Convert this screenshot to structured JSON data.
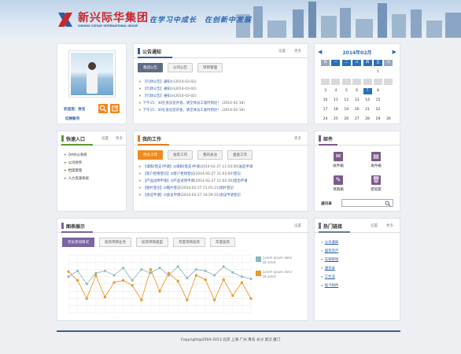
{
  "brand": {
    "name_cn": "新兴际华集团",
    "name_en": "XINXING CATHAY INTERNATIONAL GROUP",
    "slogan": "在学习中成长　在创新中发展"
  },
  "profile": {
    "welcome": "欢迎您：姓名",
    "switch_account": "切换账号"
  },
  "notice": {
    "title": "公告通知",
    "settings": "设置",
    "more": "更多",
    "tabs": [
      "集团公告",
      "公司公告",
      "项目管理"
    ],
    "items": [
      {
        "text": "【行政公告】通知①",
        "date": "(2014-03-02)"
      },
      {
        "text": "【行政公告】通知②",
        "date": "(2014-03-02)"
      },
      {
        "text": "【行政公告】通知③",
        "date": "(2014-03-02)"
      },
      {
        "text": "下午15：30在会议室开会，请全体员工准时到达！",
        "date": "(2014-02-18)"
      },
      {
        "text": "下午15：30在会议室开会，请全体员工准时到达！",
        "date": "(2014-02-18)"
      }
    ]
  },
  "calendar": {
    "month_title": "2014年02月",
    "weekdays": [
      "日",
      "一",
      "二",
      "三",
      "四",
      "五",
      "六"
    ],
    "days": [
      [
        "",
        "",
        "",
        "",
        "",
        "",
        "1"
      ],
      [
        "2",
        "3",
        "4",
        "5",
        "6",
        "7",
        "8"
      ],
      [
        "9",
        "10",
        "11",
        "12",
        "13",
        "14",
        "15"
      ],
      [
        "16",
        "17",
        "18",
        "19",
        "20",
        "21",
        "22"
      ],
      [
        "23",
        "24",
        "25",
        "26",
        "27",
        "28",
        ""
      ]
    ],
    "rows_shown": [
      [
        "",
        "",
        "",
        "",
        "",
        "",
        "1"
      ],
      [
        "",
        "",
        "",
        "",
        "",
        "",
        ""
      ],
      [
        "3",
        "4",
        "5",
        "6",
        "7",
        "8",
        ""
      ]
    ],
    "display": [
      [
        "",
        "",
        "",
        "",
        "",
        "1",
        ""
      ],
      [
        "",
        "",
        "",
        "",
        "",
        "",
        ""
      ],
      [
        "3",
        "4",
        "5",
        "6",
        "7",
        "8",
        ""
      ],
      [
        "10",
        "11",
        "12",
        "13",
        "14",
        "15",
        ""
      ],
      [
        "17",
        "18",
        "19",
        "20",
        "21",
        "22",
        ""
      ],
      [
        "24",
        "25",
        "26",
        "27",
        "28",
        "29",
        "30"
      ]
    ],
    "selected": "7",
    "accent": "#2a6fb7"
  },
  "quick": {
    "title": "快速入口",
    "settings": "设置",
    "more": "更多",
    "items": [
      "OA办公系统",
      "公司财务",
      "档案管理",
      "人力资源系统"
    ]
  },
  "work": {
    "title": "我的工作",
    "more": "更多",
    "tabs": [
      "待办工作",
      "会签工作",
      "我的关注",
      "督查工作"
    ],
    "items": [
      {
        "pre": "【请假(借支)申请】",
        "mid": "请假(借支)申请",
        "date": "(2014-02-27 11:03:59)",
        "post": "发起申请"
      },
      {
        "pre": "【客户拒接登记】",
        "mid": "客户拒接登记",
        "date": "(2014-02-27 11:03:00)",
        "post": "登记"
      },
      {
        "pre": "【产品试用申请】",
        "mid": "产品试用申请",
        "date": "(2014-02-27 11:02:30)",
        "post": "提出申请"
      },
      {
        "pre": "【图片登记】",
        "mid": "图片登记",
        "date": "(2014-02-27 11:01:21)",
        "post": "图片登记"
      },
      {
        "pre": "【会议申请】",
        "mid": "会议申请",
        "date": "(2014-02-27 10:59:31)",
        "post": "会议申请登记"
      }
    ]
  },
  "mail": {
    "title": "邮件",
    "buttons": [
      "收件箱",
      "发件箱",
      "草稿箱",
      "废纸篓"
    ],
    "contacts_label": "通讯录"
  },
  "charts": {
    "title": "图表展示",
    "settings": "设置",
    "tabs": [
      "党员党动情况",
      "投资项目业务",
      "投资项目类型",
      "月度项目投资",
      "年度投资"
    ],
    "legend": [
      "Lorem ipsum dolor sit amet",
      "Lorem ipsum dolor sit amet"
    ]
  },
  "chart_data": {
    "type": "line",
    "x": [
      1,
      2,
      3,
      4,
      5,
      6,
      7,
      8,
      9,
      10,
      11,
      12,
      13,
      14,
      15,
      16,
      17,
      18,
      19,
      20,
      21
    ],
    "series": [
      {
        "name": "Lorem ipsum dolor sit amet",
        "color": "#8ab8c4",
        "values": [
          50,
          58,
          40,
          55,
          58,
          52,
          62,
          45,
          60,
          55,
          62,
          52,
          64,
          48,
          60,
          58,
          52,
          64,
          56,
          50,
          47
        ]
      },
      {
        "name": "Lorem ipsum dolor sit amet",
        "color": "#e89a2c",
        "values": [
          57,
          45,
          20,
          52,
          22,
          42,
          45,
          38,
          18,
          60,
          30,
          55,
          44,
          18,
          52,
          46,
          18,
          46,
          24,
          42,
          20
        ]
      }
    ],
    "ylim": [
      0,
      80
    ]
  },
  "links": {
    "title": "热门链接",
    "settings": "设置",
    "more": "更多",
    "items": [
      "公司通知",
      "国资资产",
      "车辆管理",
      "通讯录",
      "工作流",
      "纸卡邮件"
    ]
  },
  "footer": {
    "text": "Copyright@2004-2013 北京 上海 广州 青岛 长沙 武汉 厦门"
  }
}
